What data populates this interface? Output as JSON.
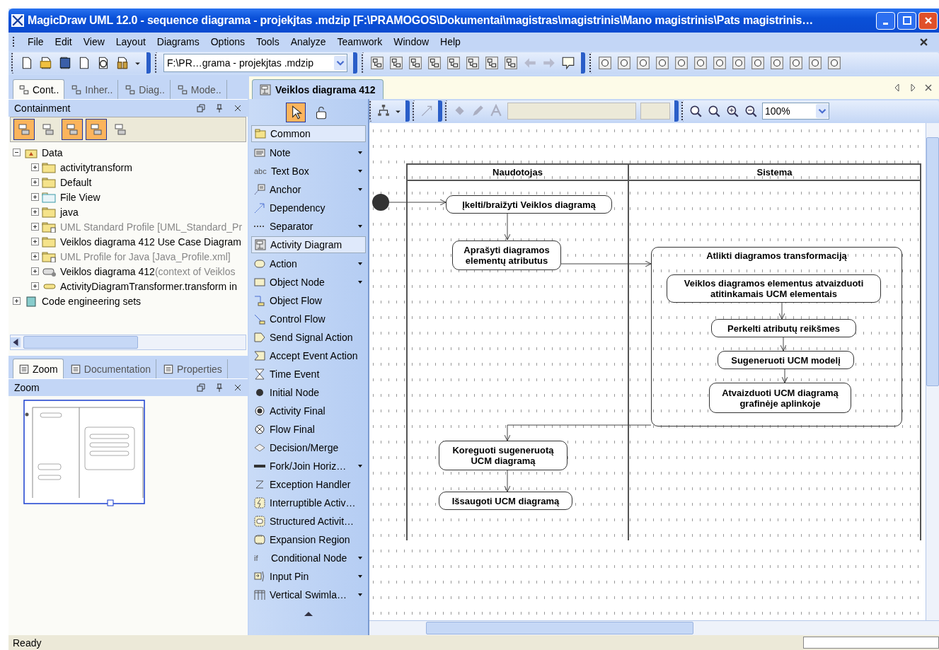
{
  "window": {
    "title": "MagicDraw UML 12.0 - sequence diagrama - projekjtas .mdzip [F:\\PRAMOGOS\\Dokumentai\\magistras\\magistrinis\\Mano magistrinis\\Pats magistrinis…"
  },
  "menu": [
    "File",
    "Edit",
    "View",
    "Layout",
    "Diagrams",
    "Options",
    "Tools",
    "Analyze",
    "Teamwork",
    "Window",
    "Help"
  ],
  "toolbar": {
    "project": "F:\\PR…grama - projekjtas .mdzip"
  },
  "left_tabs": [
    {
      "label": "Cont..",
      "selected": true
    },
    {
      "label": "Inher..",
      "selected": false
    },
    {
      "label": "Diag..",
      "selected": false
    },
    {
      "label": "Mode..",
      "selected": false
    }
  ],
  "containment": {
    "title": "Containment",
    "toggles": [
      {
        "on": true
      },
      {
        "on": false
      },
      {
        "on": true
      },
      {
        "on": true
      },
      {
        "on": false
      }
    ],
    "tree": [
      {
        "label": "Data",
        "kind": "model",
        "expanded": true,
        "dimmed": false,
        "children": [
          {
            "label": "activitytransform",
            "kind": "folder",
            "expanded": false,
            "dimmed": false
          },
          {
            "label": "Default",
            "kind": "folder",
            "expanded": false,
            "dimmed": false
          },
          {
            "label": "File View",
            "kind": "view",
            "expanded": false,
            "dimmed": false
          },
          {
            "label": "java",
            "kind": "folder",
            "expanded": false,
            "dimmed": false
          },
          {
            "label": "UML Standard Profile [UML_Standard_Pr",
            "kind": "profile",
            "expanded": false,
            "dimmed": true
          },
          {
            "label": "Veiklos diagrama 412 Use Case Diagram",
            "kind": "folder",
            "expanded": false,
            "dimmed": false
          },
          {
            "label": "UML Profile for Java [Java_Profile.xml]",
            "kind": "profile",
            "expanded": false,
            "dimmed": true
          },
          {
            "label": "Veiklos diagrama 412",
            "suffix": "(context of Veiklos",
            "kind": "activity",
            "expanded": false,
            "dimmed": false
          },
          {
            "label": "ActivityDiagramTransformer.transform in",
            "kind": "call",
            "expanded": false,
            "dimmed": false
          }
        ]
      },
      {
        "label": "Code engineering sets",
        "kind": "codeset",
        "expanded": false,
        "dimmed": false
      }
    ]
  },
  "bottom_tabs": [
    {
      "label": "Zoom",
      "selected": true
    },
    {
      "label": "Documentation",
      "selected": false
    },
    {
      "label": "Properties",
      "selected": false
    }
  ],
  "zoom_panel": {
    "title": "Zoom"
  },
  "diagram_tab": {
    "title": "Veiklos diagrama 412"
  },
  "palette_tools": [
    {
      "selected": true
    },
    {
      "selected": false
    }
  ],
  "palette": [
    {
      "label": "Common",
      "kind": "group",
      "dropdown": false
    },
    {
      "label": "Note",
      "kind": "tool",
      "dropdown": true
    },
    {
      "label": "Text Box",
      "kind": "tool",
      "dropdown": true,
      "icon_text": "abc"
    },
    {
      "label": "Anchor",
      "kind": "tool",
      "dropdown": true
    },
    {
      "label": "Dependency",
      "kind": "tool",
      "dropdown": false
    },
    {
      "label": "Separator",
      "kind": "tool",
      "dropdown": true
    },
    {
      "label": "Activity Diagram",
      "kind": "group",
      "dropdown": false
    },
    {
      "label": "Action",
      "kind": "tool",
      "dropdown": true
    },
    {
      "label": "Object Node",
      "kind": "tool",
      "dropdown": true
    },
    {
      "label": "Object Flow",
      "kind": "tool",
      "dropdown": false
    },
    {
      "label": "Control Flow",
      "kind": "tool",
      "dropdown": false
    },
    {
      "label": "Send Signal Action",
      "kind": "tool",
      "dropdown": false
    },
    {
      "label": "Accept Event Action",
      "kind": "tool",
      "dropdown": false
    },
    {
      "label": "Time Event",
      "kind": "tool",
      "dropdown": false
    },
    {
      "label": "Initial Node",
      "kind": "tool",
      "dropdown": false
    },
    {
      "label": "Activity Final",
      "kind": "tool",
      "dropdown": false
    },
    {
      "label": "Flow Final",
      "kind": "tool",
      "dropdown": false
    },
    {
      "label": "Decision/Merge",
      "kind": "tool",
      "dropdown": false
    },
    {
      "label": "Fork/Join Horiz…",
      "kind": "tool",
      "dropdown": true
    },
    {
      "label": "Exception Handler",
      "kind": "tool",
      "dropdown": false
    },
    {
      "label": "Interruptible Activ…",
      "kind": "tool",
      "dropdown": false
    },
    {
      "label": "Structured Activit…",
      "kind": "tool",
      "dropdown": false
    },
    {
      "label": "Expansion Region",
      "kind": "tool",
      "dropdown": false
    },
    {
      "label": "Conditional Node",
      "kind": "tool",
      "dropdown": true,
      "icon_text": "if"
    },
    {
      "label": "Input Pin",
      "kind": "tool",
      "dropdown": true
    },
    {
      "label": "Vertical Swimla…",
      "kind": "tool",
      "dropdown": true
    }
  ],
  "zoom_level": "100%",
  "diagram": {
    "lanes": [
      {
        "title": "Naudotojas"
      },
      {
        "title": "Sistema"
      }
    ],
    "group": {
      "title": "Atlikti diagramos transformaciją"
    },
    "actions": [
      {
        "label": "Įkelti/braižyti Veiklos diagramą"
      },
      {
        "label": "Aprašyti diagramos elementų atributus"
      },
      {
        "label": "Veiklos diagramos elementus atvaizduoti atitinkamais UCM elementais"
      },
      {
        "label": "Perkelti atributų reikšmes"
      },
      {
        "label": "Sugeneruoti UCM modelį"
      },
      {
        "label": "Atvaizduoti UCM diagramą grafinėje aplinkoje"
      },
      {
        "label": "Koreguoti sugeneruotą UCM diagramą"
      },
      {
        "label": "Išsaugoti UCM diagramą"
      }
    ]
  },
  "status_bar": {
    "text": "Ready"
  }
}
